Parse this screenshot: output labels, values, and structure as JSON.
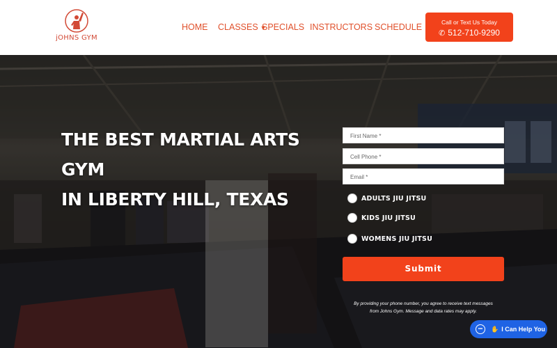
{
  "header": {
    "logo_text": "jOHNS GYM",
    "nav": {
      "home": "HOME",
      "classes": "CLASSES",
      "specials": "SPECIALS",
      "instructors": "INSTRUCTORS",
      "schedule": "SCHEDULE"
    },
    "call": {
      "label": "Call or Text Us Today",
      "phone": "512-710-9290"
    }
  },
  "hero": {
    "title_line1": "THE BEST MARTIAL ARTS GYM",
    "title_line2": "IN LIBERTY HILL, TEXAS"
  },
  "form": {
    "first_name_placeholder": "First Name *",
    "phone_placeholder": "Cell Phone *",
    "email_placeholder": "Email *",
    "options": [
      "ADULTS JIU JITSU",
      "KIDS JIU JITSU",
      "WOMENS JIU JITSU"
    ],
    "submit_label": "Submit",
    "disclaimer_line1": "By providing your phone number, you agree to receive text messages",
    "disclaimer_line2": "from Johns Gym.  Message and data rates may apply."
  },
  "chat": {
    "label": "I Can Help You"
  },
  "colors": {
    "accent": "#f2421b",
    "nav_text": "#e0502b",
    "chat": "#1f63e4"
  },
  "icons": {
    "logo": "raised-arm-fighter-logo",
    "phone": "phone-icon",
    "classes_dropdown": "chevron-down-icon",
    "chat": "chat-bubble-icon",
    "wave": "waving-hand-icon"
  }
}
